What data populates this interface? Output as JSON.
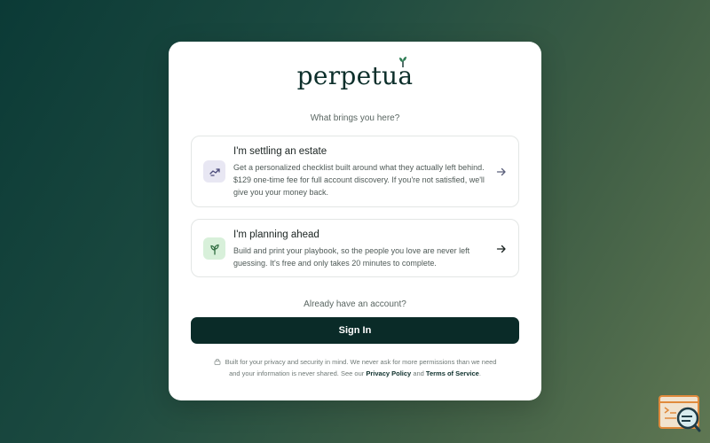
{
  "brand": {
    "logo_text": "perpetua"
  },
  "prompt": {
    "question": "What brings you here?"
  },
  "options": [
    {
      "title": "I'm settling an estate",
      "description": "Get a personalized checklist built around what they actually left behind. $129 one-time fee for full account discovery. If you're not satisfied, we'll give you your money back.",
      "icon": "handshake-icon"
    },
    {
      "title": "I'm planning ahead",
      "description": "Build and print your playbook, so the people you love are never left guessing. It's free and only takes 20 minutes to complete.",
      "icon": "sprout-icon"
    }
  ],
  "account": {
    "prompt": "Already have an account?",
    "signin_label": "Sign In"
  },
  "footer": {
    "text_before": "Built for your privacy and security in mind. We never ask for more permissions than we need and your information is never shared. See our",
    "privacy_link": "Privacy Policy",
    "and_text": "and",
    "terms_link": "Terms of Service",
    "period": "."
  },
  "colors": {
    "primary": "#0a2b28",
    "estate_icon_bg": "#e8e7f3",
    "plan_icon_bg": "#d8f0da"
  }
}
